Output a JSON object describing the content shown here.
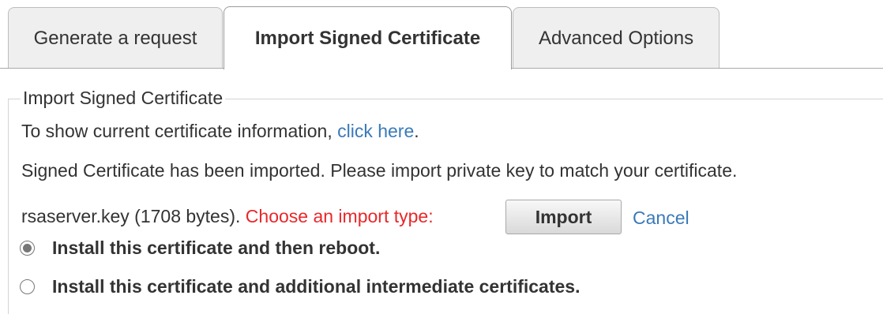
{
  "tabs": [
    {
      "label": "Generate a request",
      "active": false
    },
    {
      "label": "Import Signed Certificate",
      "active": true
    },
    {
      "label": "Advanced Options",
      "active": false
    }
  ],
  "section": {
    "legend": "Import Signed Certificate",
    "info_text": "To show current certificate information, ",
    "info_link": "click here",
    "info_suffix": ".",
    "status_message": "Signed Certificate has been imported. Please import private key to match your certificate.",
    "key_file": "rsaserver.key (1708 bytes). ",
    "choose_prompt": "Choose an import type:",
    "import_button": "Import",
    "cancel_link": "Cancel"
  },
  "import_options": [
    {
      "label": "Install this certificate and then reboot.",
      "selected": true
    },
    {
      "label": "Install this certificate and additional intermediate certificates.",
      "selected": false
    }
  ],
  "colors": {
    "link": "#3a7ab8",
    "error_prompt": "#e8272a",
    "text": "#333333"
  }
}
